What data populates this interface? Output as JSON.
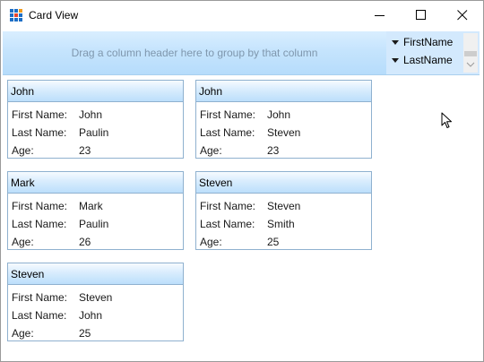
{
  "window": {
    "title": "Card View"
  },
  "group_panel": {
    "hint": "Drag a column header here to group by that column"
  },
  "sort_fields": [
    "FirstName",
    "LastName"
  ],
  "field_labels": {
    "first_name": "First Name:",
    "last_name": "Last Name:",
    "age": "Age:"
  },
  "cards": [
    {
      "header": "John",
      "first_name": "John",
      "last_name": "Paulin",
      "age": "23"
    },
    {
      "header": "John",
      "first_name": "John",
      "last_name": "Steven",
      "age": "23"
    },
    {
      "header": "Mark",
      "first_name": "Mark",
      "last_name": "Paulin",
      "age": "26"
    },
    {
      "header": "Steven",
      "first_name": "Steven",
      "last_name": "Smith",
      "age": "25"
    },
    {
      "header": "Steven",
      "first_name": "Steven",
      "last_name": "John",
      "age": "25"
    }
  ],
  "colors": {
    "icon_red": "#e8442c",
    "icon_orange": "#f29b1d",
    "icon_blue": "#1e6fc6",
    "group_panel_bg": "#c5e4fd",
    "card_border": "#8fb1cf"
  }
}
